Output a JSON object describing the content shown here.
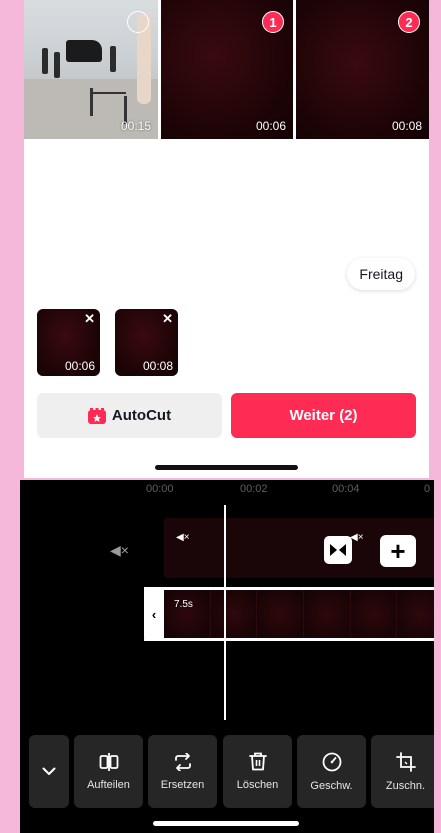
{
  "picker": {
    "thumbnails": [
      {
        "duration": "00:15",
        "badge": ""
      },
      {
        "duration": "00:06",
        "badge": "1"
      },
      {
        "duration": "00:08",
        "badge": "2"
      }
    ],
    "suggestion_chip": "Freitag",
    "selected": [
      {
        "duration": "00:06"
      },
      {
        "duration": "00:08"
      }
    ],
    "autocut_label": "AutoCut",
    "next_label": "Weiter (2)"
  },
  "editor": {
    "ruler": [
      "00:00",
      "00:02",
      "00:04",
      "0"
    ],
    "clip_length": "7.5s",
    "add_label": "+",
    "tools": [
      {
        "label": "Aufteilen",
        "icon": "split-icon"
      },
      {
        "label": "Ersetzen",
        "icon": "replace-icon"
      },
      {
        "label": "Löschen",
        "icon": "trash-icon"
      },
      {
        "label": "Geschw.",
        "icon": "speed-icon"
      },
      {
        "label": "Zuschn.",
        "icon": "crop-icon"
      }
    ]
  },
  "colors": {
    "accent": "#fe2c55",
    "top_background": "#ffffff",
    "editor_background": "#000000",
    "page_background": "#f5b8da"
  }
}
